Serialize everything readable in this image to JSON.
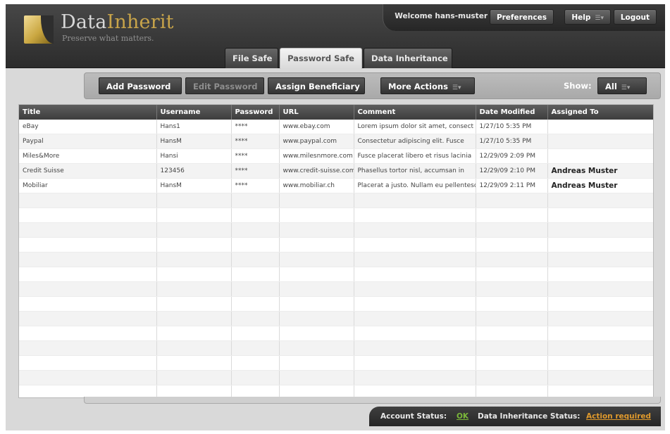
{
  "brand": {
    "name_part1": "Data",
    "name_part2": "Inherit",
    "tagline": "Preserve what matters.",
    "accent_color": "#c8a44a"
  },
  "topbar": {
    "welcome": "Welcome hans-muster",
    "preferences": "Preferences",
    "help": "Help",
    "logout": "Logout"
  },
  "tabs": [
    {
      "label": "File Safe",
      "active": false
    },
    {
      "label": "Password Safe",
      "active": true
    },
    {
      "label": "Data Inheritance",
      "active": false
    }
  ],
  "toolbar": {
    "add_password": "Add Password",
    "edit_password": "Edit Password",
    "assign_beneficiary": "Assign Beneficiary",
    "more_actions": "More Actions",
    "show_label": "Show:",
    "show_value": "All"
  },
  "table": {
    "columns": [
      "Title",
      "Username",
      "Password",
      "URL",
      "Comment",
      "Date Modified",
      "Assigned To"
    ],
    "rows": [
      [
        "eBay",
        "Hans1",
        "****",
        "www.ebay.com",
        "Lorem ipsum dolor sit amet, consect",
        "1/27/10 5:35 PM",
        ""
      ],
      [
        "Paypal",
        "HansM",
        "****",
        "www.paypal.com",
        "Consectetur adipiscing elit. Fusce",
        "1/27/10 5:35 PM",
        ""
      ],
      [
        "Miles&More",
        "Hansi",
        "****",
        "www.milesnmore.com",
        "Fusce placerat libero et risus lacinia",
        "12/29/09 2:09 PM",
        ""
      ],
      [
        "Credit Suisse",
        "123456",
        "****",
        "www.credit-suisse.com",
        "Phasellus tortor nisl, accumsan in",
        "12/29/09 2:10 PM",
        "Andreas Muster"
      ],
      [
        "Mobiliar",
        "HansM",
        "****",
        "www.mobiliar.ch",
        "Placerat a justo. Nullam eu pellentesque",
        "12/29/09 2:11 PM",
        "Andreas Muster"
      ]
    ]
  },
  "status": {
    "account_label": "Account Status:",
    "account_value": "OK",
    "inheritance_label": "Data Inheritance Status:",
    "inheritance_value": "Action required",
    "ok_color": "#7bb83a",
    "warn_color": "#e09a2d"
  },
  "icons": {
    "menu": "menu-dropdown-icon",
    "logo": "logo-mark-icon"
  }
}
